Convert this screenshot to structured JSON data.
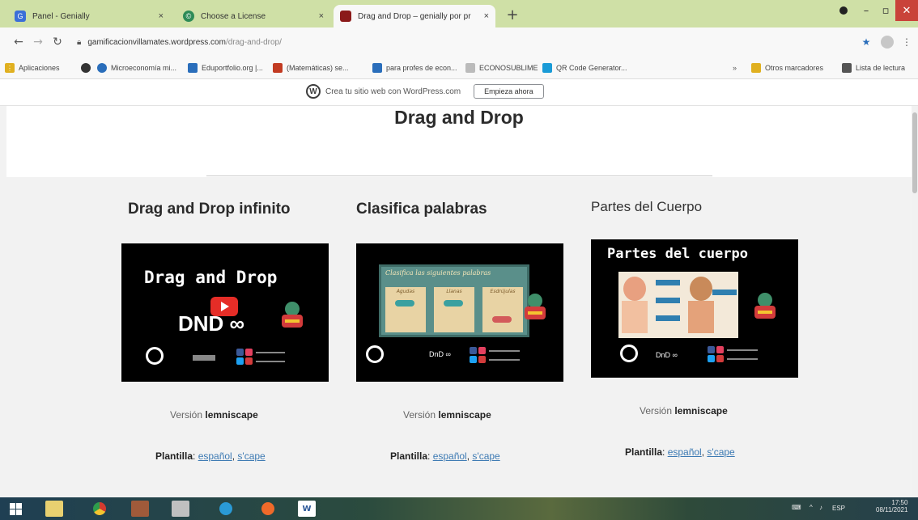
{
  "browser": {
    "tabs": [
      {
        "title": "Panel - Genially",
        "close": "×",
        "fav_color": "#3b6fd8",
        "fav_glyph": "G"
      },
      {
        "title": "Choose a License",
        "close": "×",
        "fav_color": "#2e8b57",
        "fav_glyph": "©"
      },
      {
        "title": "Drag and Drop – genially por pr",
        "close": "×",
        "fav_color": "#8b1a1a",
        "fav_glyph": ""
      }
    ],
    "new_tab": "+",
    "address": {
      "domain": "gamificacionvillamates.wordpress.com",
      "path": "/drag-and-drop/"
    },
    "bookmarks": [
      {
        "label": "Aplicaciones",
        "icon_color": "#e0b020"
      },
      {
        "label": "",
        "icon_color": "#333333"
      },
      {
        "label": "Microeconomía mi...",
        "icon_color": "#2a6ebb"
      },
      {
        "label": "Eduportfolio.org |...",
        "icon_color": "#2a6ebb"
      },
      {
        "label": "(Matemáticas) se...",
        "icon_color": "#c23b22"
      },
      {
        "label": "para profes de econ...",
        "icon_color": "#2a6ebb"
      },
      {
        "label": "ECONOSUBLIME",
        "icon_color": "#888888"
      },
      {
        "label": "QR Code Generator...",
        "icon_color": "#1a9bd7"
      },
      {
        "label": "Otros marcadores",
        "icon_color": "#e0b020"
      },
      {
        "label": "Lista de lectura",
        "icon_color": "#555555"
      }
    ]
  },
  "wp_banner": {
    "text": "Crea tu sitio web con WordPress.com",
    "button": "Empieza ahora",
    "logo": "W"
  },
  "page": {
    "title": "Drag and Drop",
    "cards": [
      {
        "heading": "Drag and Drop infinito",
        "thumb_title": "Drag and Drop",
        "thumb_sub": "DND ∞",
        "version_label": "Versión",
        "version_name": "lemniscape",
        "plantilla_label": "Plantilla",
        "link1": "español",
        "link2": "s'cape"
      },
      {
        "heading": "Clasifica palabras",
        "thumb_title": "Clasifica las siguientes palabras",
        "col_labels": [
          "Agudas",
          "Llanas",
          "Esdrújulas"
        ],
        "thumb_sub": "DnD ∞",
        "version_label": "Versión",
        "version_name": "lemniscape",
        "plantilla_label": "Plantilla",
        "link1": "español",
        "link2": "s'cape"
      },
      {
        "heading": "Partes del Cuerpo",
        "thumb_title": "Partes del cuerpo",
        "thumb_sub": "DnD ∞",
        "version_label": "Versión",
        "version_name": "lemniscape",
        "plantilla_label": "Plantilla",
        "link1": "español",
        "link2": "s'cape"
      }
    ]
  },
  "taskbar": {
    "word_icon": "W",
    "tray_lang": "ESP",
    "time": "17:50",
    "date": "08/11/2021"
  },
  "colors": {
    "link": "#3d7ab3",
    "tabbar": "#cfe0a6",
    "taskbar": "#1f3f53"
  }
}
